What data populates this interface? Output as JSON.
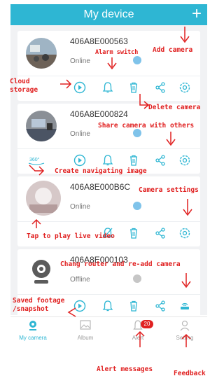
{
  "header": {
    "title": "My device",
    "add_symbol": "+"
  },
  "devices": [
    {
      "id": "406A8E000563",
      "status": "Online"
    },
    {
      "id": "406A8E000824",
      "status": "Online"
    },
    {
      "id": "406A8E000B6C",
      "status": "Online"
    },
    {
      "id": "406A8E000103",
      "status": "Offline"
    }
  ],
  "tabs": [
    {
      "label": "My camera",
      "icon": "location-pin-icon"
    },
    {
      "label": "Album",
      "icon": "image-icon"
    },
    {
      "label": "Alert",
      "icon": "bell-icon",
      "badge": "20"
    },
    {
      "label": "Setting",
      "icon": "user-icon"
    }
  ],
  "annotations": {
    "add_camera": "Add camera",
    "alarm_switch": "Alarm switch",
    "cloud_storage": "Cloud\nstorage",
    "delete_camera": "Delete camera",
    "share_camera": "Share camera with others",
    "create_navigating": "Create navigating image",
    "camera_settings": "Camera settings",
    "tap_to_play": "Tap to play live video",
    "change_router": "Chang router and re-add camera",
    "saved_footage": "Saved footage\n/snapshot",
    "alert_messages": "Alert messages",
    "feedback": "Feedback"
  },
  "colors": {
    "accent": "#2eb6d3",
    "annotation": "#e02020"
  }
}
